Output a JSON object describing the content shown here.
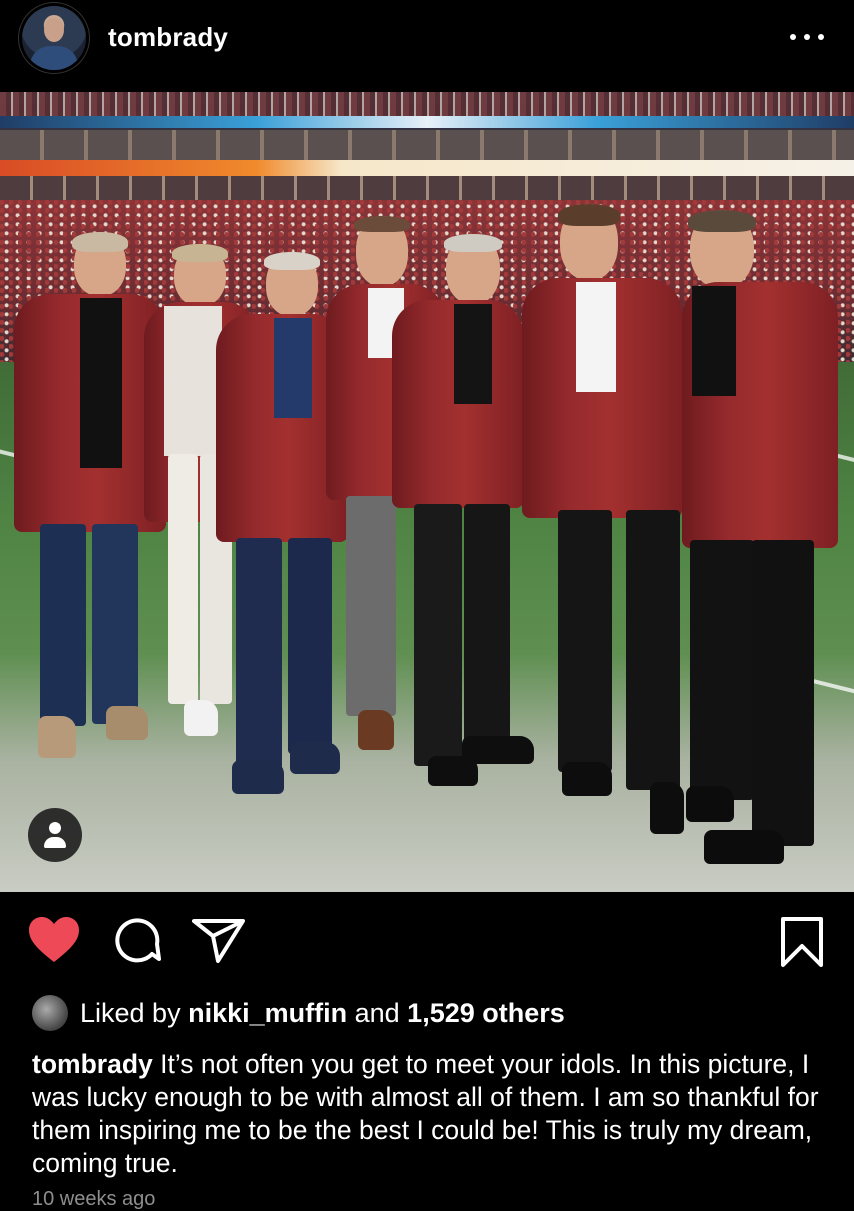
{
  "post": {
    "username": "tombrady",
    "avatar_icon": "profile-avatar"
  },
  "photo": {
    "tag_icon": "person-icon"
  },
  "actions": {
    "liked": true,
    "like_color": "#ed4956"
  },
  "likes": {
    "prefix": "Liked by ",
    "liker": "nikki_muffin",
    "middle": " and ",
    "count": "1,529 others"
  },
  "caption": {
    "username": "tombrady",
    "text": " It’s not often you get to meet your idols. In this picture, I was lucky enough to be with almost all of them. I am so thankful for them inspiring me to be the best I could be! This is truly my dream, coming true."
  },
  "time": {
    "label": "10 weeks ago"
  }
}
